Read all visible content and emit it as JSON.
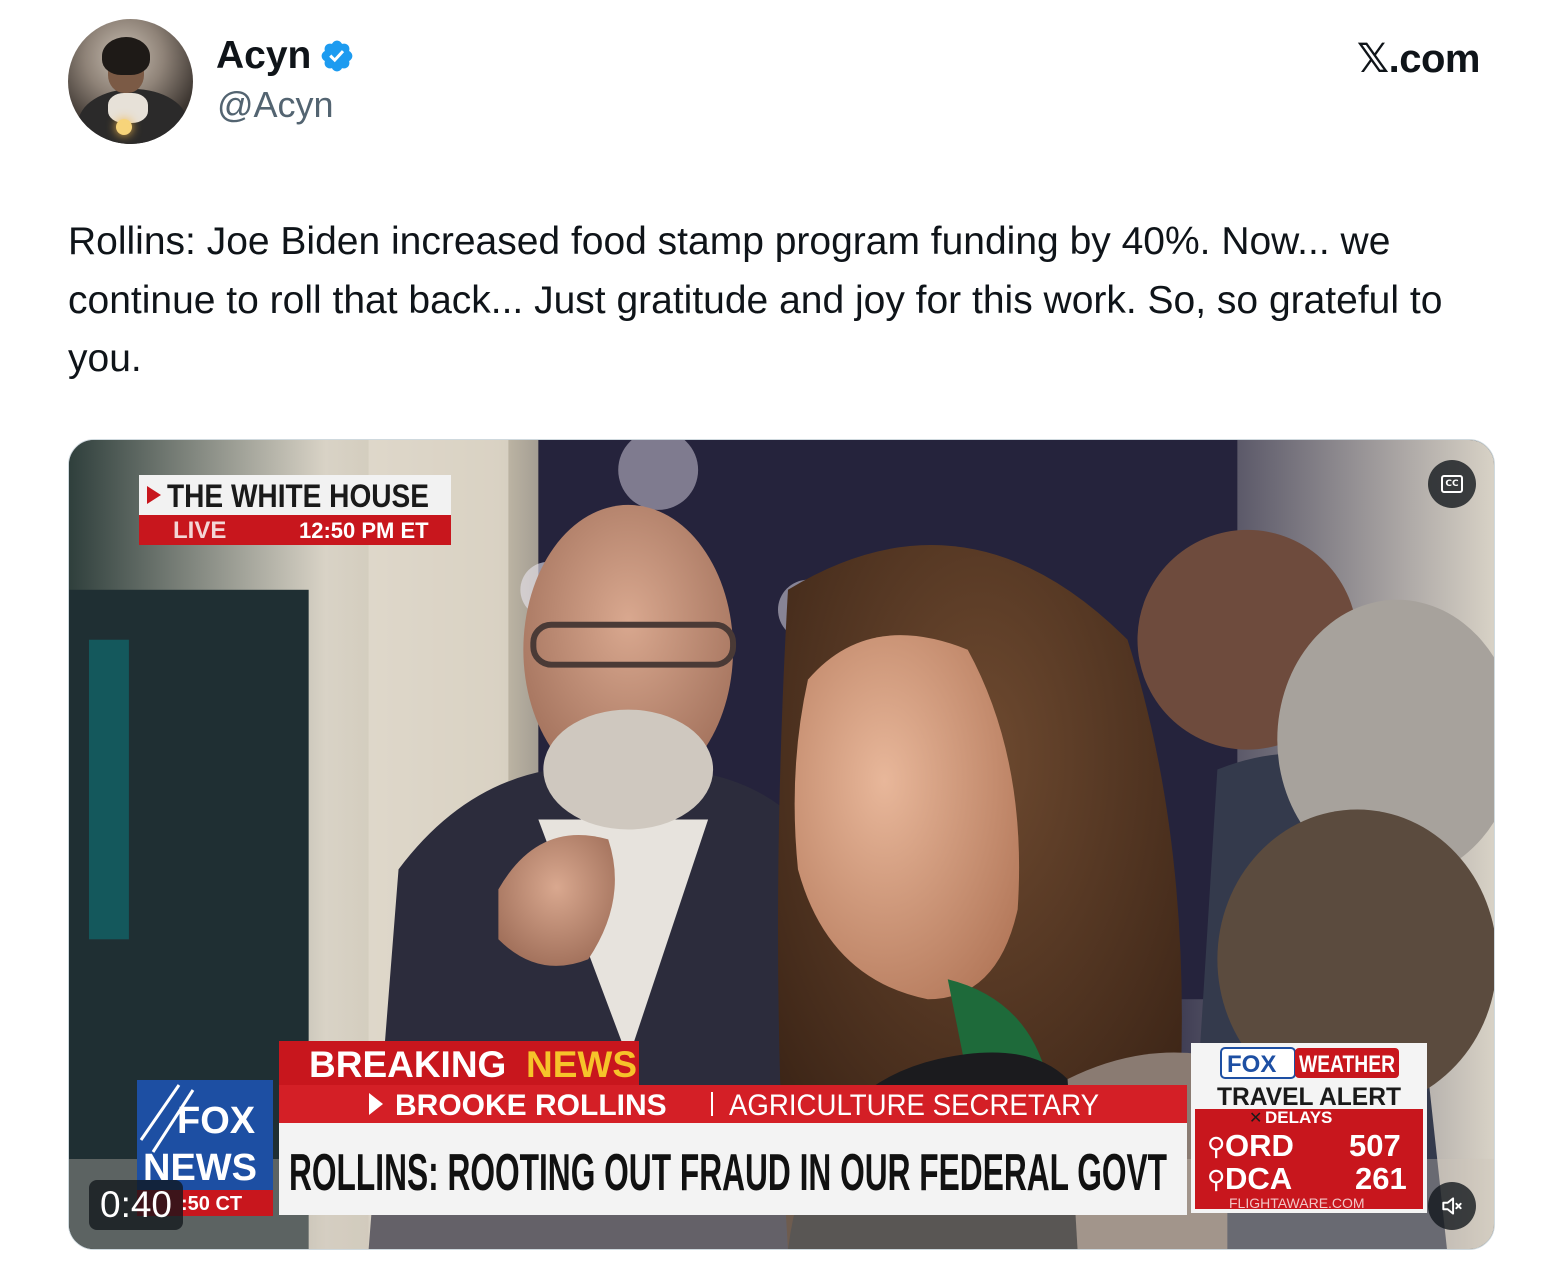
{
  "author": {
    "name": "Acyn",
    "handle": "@Acyn",
    "verified": true
  },
  "brand": "𝕏.com",
  "tweet": {
    "text": "Rollins: Joe Biden increased food stamp program funding by 40%. Now... we continue to roll that back... Just gratitude and joy for this work. So, so grateful to you."
  },
  "video": {
    "timestamp": "0:40",
    "cc_label": "CC",
    "broadcast": {
      "location_bug": "THE WHITE HOUSE",
      "live_label": "LIVE",
      "live_time": "12:50 PM ET",
      "breaking_word1": "BREAKING",
      "breaking_word2": "NEWS",
      "name_line": "BROOKE ROLLINS",
      "title_line": "AGRICULTURE SECRETARY",
      "headline": "ROLLINS: ROOTING OUT FRAUD IN OUR FEDERAL GOVT",
      "logo_line1": "FOX",
      "logo_line2": "NEWS",
      "clock": ":50 CT",
      "weather_fox": "FOX",
      "weather_word": "WEATHER",
      "travel_alert": "TRAVEL ALERT",
      "delays": "DELAYS",
      "airports": [
        {
          "code": "ORD",
          "count": "507"
        },
        {
          "code": "DCA",
          "count": "261"
        }
      ],
      "source": "FLIGHTAWARE.COM"
    }
  },
  "colors": {
    "text_primary": "#0f1419",
    "text_secondary": "#536471",
    "verified_blue": "#1d9bf0",
    "fox_red": "#c8161d",
    "fox_blue": "#1d4fa3"
  },
  "icons": {
    "verified": "verified-badge-icon",
    "cc": "closed-captions-icon",
    "mute": "muted-speaker-icon"
  }
}
